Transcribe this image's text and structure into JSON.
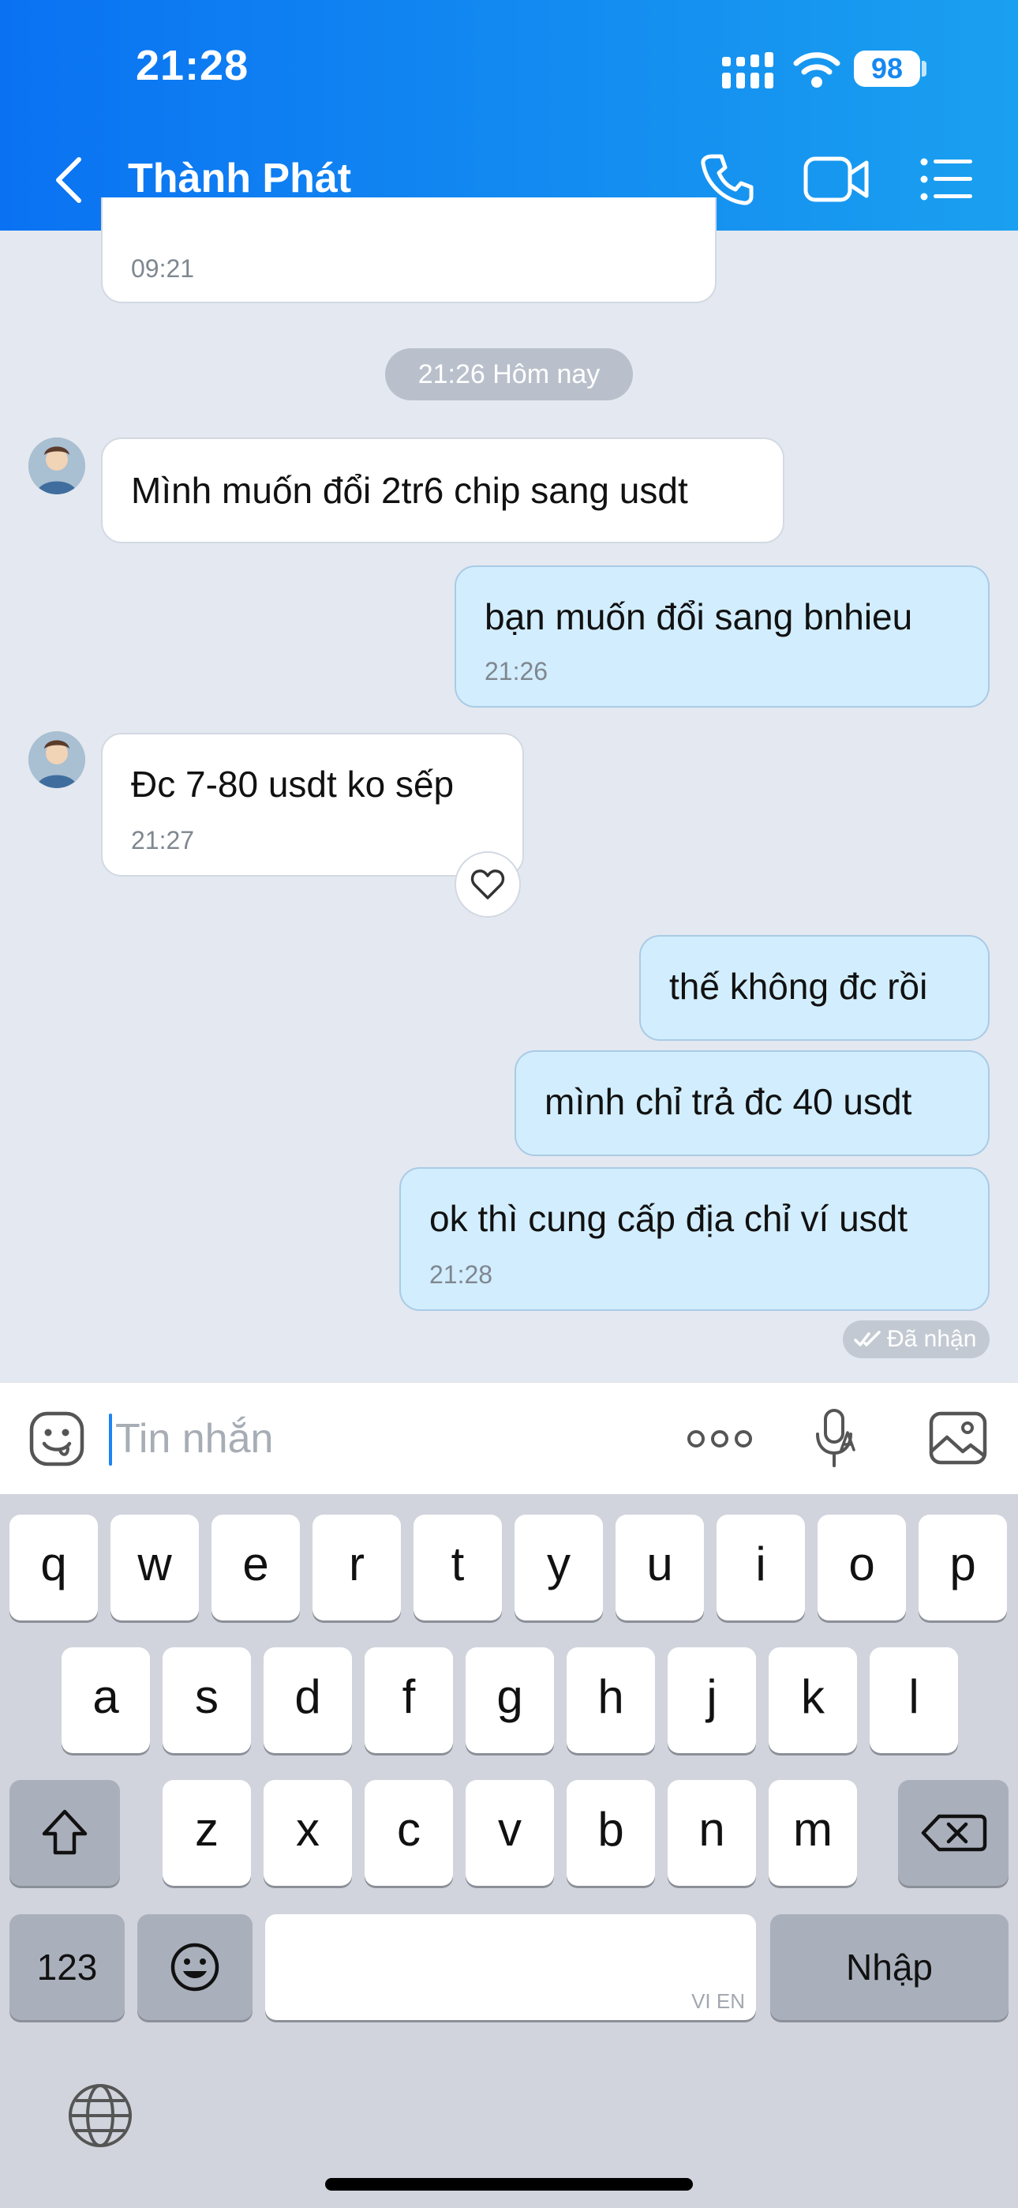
{
  "status_bar": {
    "time": "21:28",
    "battery": "98"
  },
  "header": {
    "contact_name": "Thành Phát"
  },
  "chat": {
    "partial_message_time": "09:21",
    "date_divider": "21:26 Hôm nay",
    "messages": [
      {
        "direction": "in",
        "text": "Mình muốn đổi 2tr6 chip sang usdt",
        "time": ""
      },
      {
        "direction": "out",
        "text": "bạn muốn đổi sang bnhieu",
        "time": "21:26"
      },
      {
        "direction": "in",
        "text": "Đc 7-80 usdt ko sếp",
        "time": "21:27"
      },
      {
        "direction": "out",
        "text": "thế không đc rồi",
        "time": ""
      },
      {
        "direction": "out",
        "text": "mình chỉ trả đc 40 usdt",
        "time": ""
      },
      {
        "direction": "out",
        "text": "ok thì cung cấp địa chỉ ví usdt",
        "time": "21:28"
      }
    ],
    "delivery_status": "Đã nhận"
  },
  "composer": {
    "placeholder": "Tin nhắn"
  },
  "keyboard": {
    "row1": [
      "q",
      "w",
      "e",
      "r",
      "t",
      "y",
      "u",
      "i",
      "o",
      "p"
    ],
    "row2": [
      "a",
      "s",
      "d",
      "f",
      "g",
      "h",
      "j",
      "k",
      "l"
    ],
    "row3": [
      "z",
      "x",
      "c",
      "v",
      "b",
      "n",
      "m"
    ],
    "numbers_key": "123",
    "space_hint": "VI EN",
    "return_key": "Nhập"
  },
  "colors": {
    "header_start": "#0a72f2",
    "header_end": "#1aa0f0",
    "incoming_bubble": "#ffffff",
    "outgoing_bubble": "#d2edfd",
    "chat_background": "#e4e8f0",
    "cursor": "#1c83f2"
  },
  "icons": {
    "back": "chevron-left-icon",
    "call": "phone-icon",
    "video": "video-camera-icon",
    "menu": "list-menu-icon",
    "emoji": "sticker-face-icon",
    "more": "ellipsis-icon",
    "voice": "microphone-icon",
    "image": "image-icon",
    "reaction": "heart-icon",
    "shift": "shift-arrow-icon",
    "delete": "backspace-icon",
    "emoji_keyboard": "emoji-key-icon",
    "globe": "globe-icon"
  }
}
